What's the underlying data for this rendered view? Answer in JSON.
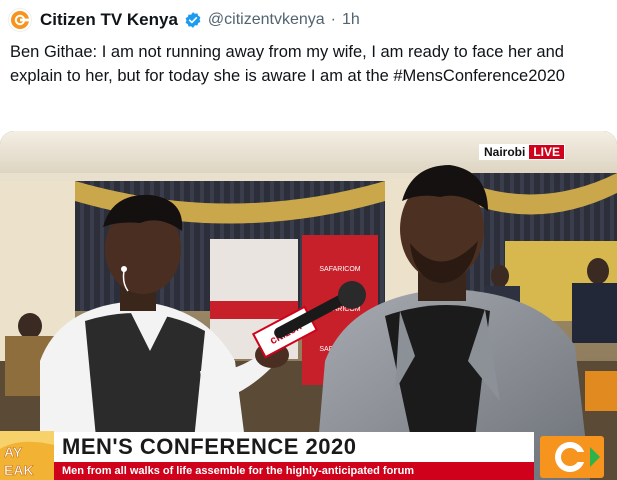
{
  "account": {
    "display_name": "Citizen TV Kenya",
    "handle": "@citizentvkenya",
    "separator": "·",
    "time": "1h",
    "avatar_icon": "citizen-logo-icon",
    "verified_icon": "verified-badge-icon",
    "brand_color": "#f7941d",
    "verified_color": "#1d9bf0"
  },
  "tweet": {
    "text": "Ben Githae: I am not running away from my wife, I am ready to face her and explain to her, but for today she is aware I am at the #MensConference2020"
  },
  "video": {
    "live_city": "Nairobi",
    "live_label": "LIVE",
    "banner_title": "MEN'S CONFERENCE 2020",
    "banner_subtitle": "Men from all walks of life assemble for the highly-anticipated forum",
    "mic_flag_text": "citizen",
    "banner_brand_text": "SAFARICOM",
    "show_logo_text": "AY\nEAK",
    "accent_red": "#d0021b",
    "accent_orange": "#f7941d"
  }
}
